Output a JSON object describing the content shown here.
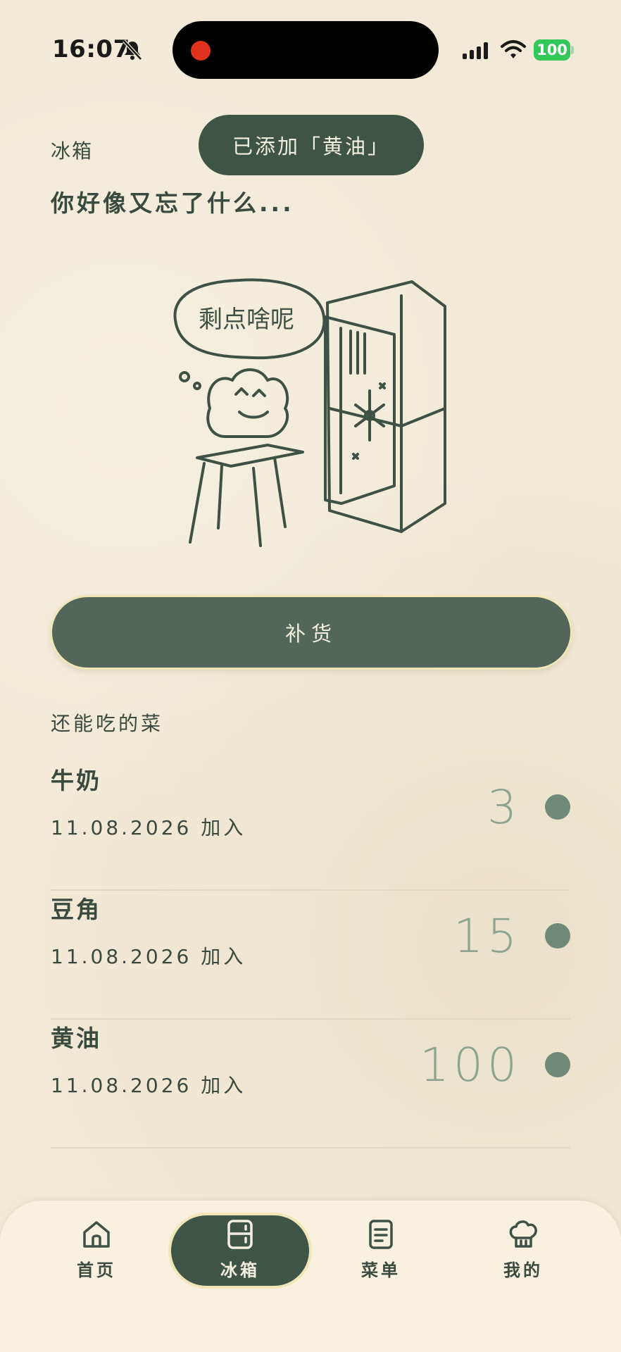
{
  "status_bar": {
    "time": "16:07",
    "battery": "100"
  },
  "toast": "已添加「黄油」",
  "header": {
    "title": "冰箱",
    "subtitle": "你好像又忘了什么..."
  },
  "illustration": {
    "caption": "剩点啥呢"
  },
  "restock_label": "补货",
  "section_title": "还能吃的菜",
  "items": [
    {
      "name": "牛奶",
      "date": "11.08.2026 加入",
      "qty": "3"
    },
    {
      "name": "豆角",
      "date": "11.08.2026 加入",
      "qty": "15"
    },
    {
      "name": "黄油",
      "date": "11.08.2026 加入",
      "qty": "100"
    }
  ],
  "tabs": [
    {
      "label": "首页",
      "icon": "home-icon"
    },
    {
      "label": "冰箱",
      "icon": "fridge-icon",
      "active": true
    },
    {
      "label": "菜单",
      "icon": "menu-list-icon"
    },
    {
      "label": "我的",
      "icon": "chef-hat-icon"
    }
  ],
  "colors": {
    "primary": "#3e5447",
    "background": "#f2ead6",
    "accent_dot": "#6f8a78"
  }
}
